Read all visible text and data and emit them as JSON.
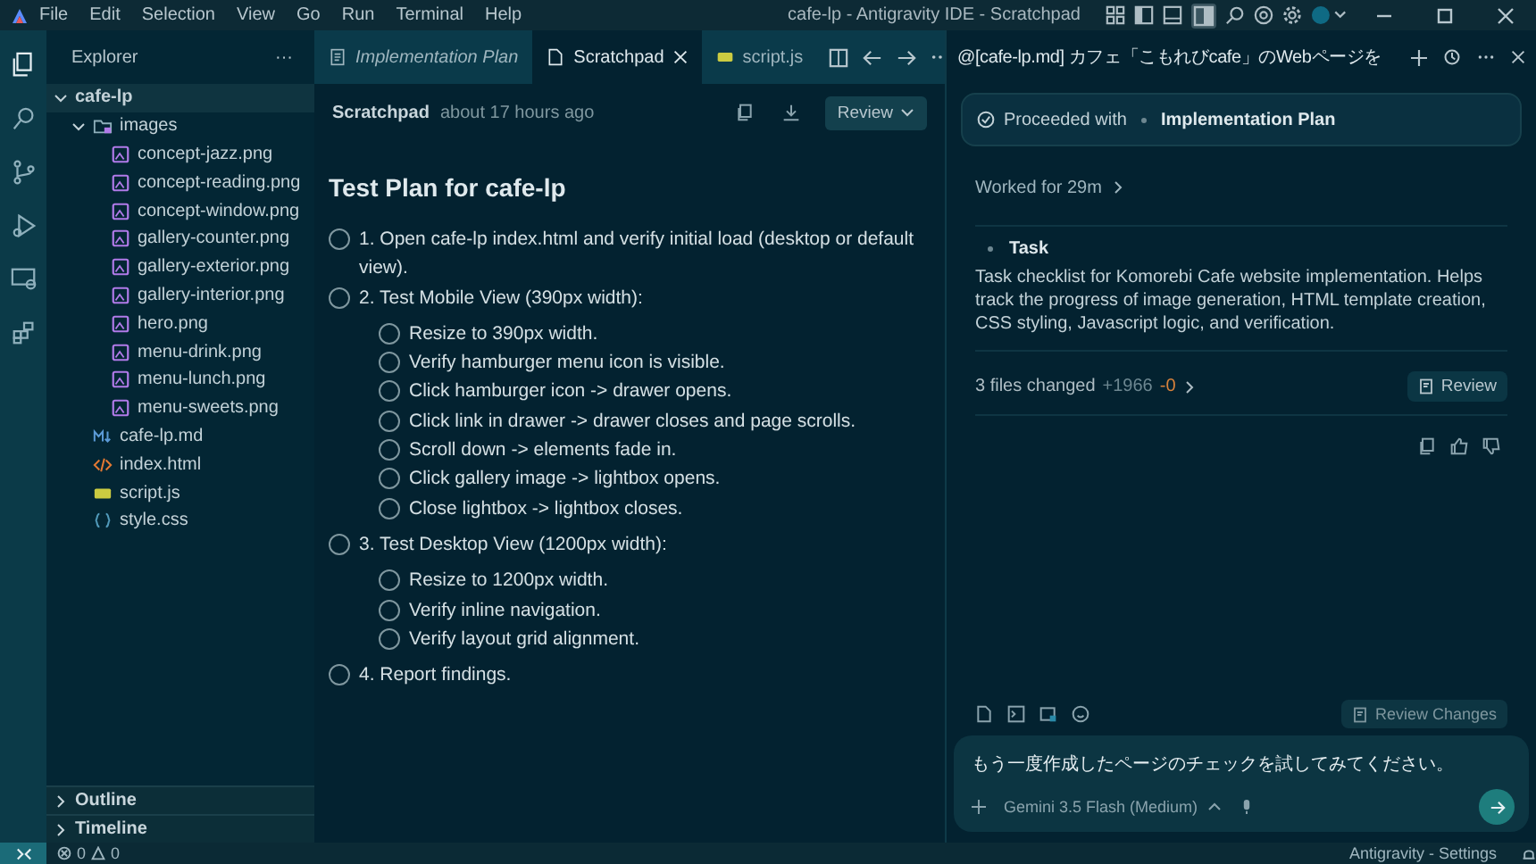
{
  "menu": [
    "File",
    "Edit",
    "Selection",
    "View",
    "Go",
    "Run",
    "Terminal",
    "Help"
  ],
  "window_title": "cafe-lp - Antigravity IDE - Scratchpad",
  "explorer": {
    "title": "Explorer",
    "more": "···",
    "tree": [
      {
        "label": "cafe-lp",
        "kind": "folder",
        "expanded": true,
        "selected": true,
        "children": [
          {
            "label": "images",
            "kind": "folder",
            "expanded": true,
            "selected": false,
            "children": [
              {
                "label": "concept-jazz.png",
                "kind": "image",
                "selected": false
              },
              {
                "label": "concept-reading.png",
                "kind": "image",
                "selected": false
              },
              {
                "label": "concept-window.png",
                "kind": "image",
                "selected": false
              },
              {
                "label": "gallery-counter.png",
                "kind": "image",
                "selected": false
              },
              {
                "label": "gallery-exterior.png",
                "kind": "image",
                "selected": false
              },
              {
                "label": "gallery-interior.png",
                "kind": "image",
                "selected": false
              },
              {
                "label": "hero.png",
                "kind": "image",
                "selected": false
              },
              {
                "label": "menu-drink.png",
                "kind": "image",
                "selected": false
              },
              {
                "label": "menu-lunch.png",
                "kind": "image",
                "selected": false
              },
              {
                "label": "menu-sweets.png",
                "kind": "image",
                "selected": false
              }
            ]
          },
          {
            "label": "cafe-lp.md",
            "kind": "markdown",
            "selected": false
          },
          {
            "label": "index.html",
            "kind": "html",
            "selected": false
          },
          {
            "label": "script.js",
            "kind": "js",
            "selected": false
          },
          {
            "label": "style.css",
            "kind": "css",
            "selected": false
          }
        ]
      }
    ],
    "sections": [
      {
        "label": "Outline",
        "expanded": false
      },
      {
        "label": "Timeline",
        "expanded": false
      }
    ]
  },
  "editor": {
    "tabs": [
      {
        "label": "Implementation Plan",
        "kind": "plan",
        "selected": false
      },
      {
        "label": "Scratchpad",
        "kind": "file",
        "selected": true
      },
      {
        "label": "script.js",
        "kind": "js",
        "selected": false
      }
    ],
    "header": {
      "title": "Scratchpad",
      "time": "about 17 hours ago",
      "review": "Review"
    },
    "heading": "Test Plan for cafe-lp",
    "items": [
      {
        "text": "1. Open cafe-lp index.html and verify initial load (desktop or default view).",
        "checked": false
      },
      {
        "text": "2. Test Mobile View (390px width):",
        "checked": false,
        "children": [
          {
            "text": "Resize to 390px width.",
            "checked": false
          },
          {
            "text": "Verify hamburger menu icon is visible.",
            "checked": false
          },
          {
            "text": "Click hamburger icon -> drawer opens.",
            "checked": false
          },
          {
            "text": "Click link in drawer -> drawer closes and page scrolls.",
            "checked": false
          },
          {
            "text": "Scroll down -> elements fade in.",
            "checked": false
          },
          {
            "text": "Click gallery image -> lightbox opens.",
            "checked": false
          },
          {
            "text": "Close lightbox -> lightbox closes.",
            "checked": false
          }
        ]
      },
      {
        "text": "3. Test Desktop View (1200px width):",
        "checked": false,
        "children": [
          {
            "text": "Resize to 1200px width.",
            "checked": false
          },
          {
            "text": "Verify inline navigation.",
            "checked": false
          },
          {
            "text": "Verify layout grid alignment.",
            "checked": false
          }
        ]
      },
      {
        "text": "4. Report findings.",
        "checked": false
      }
    ]
  },
  "chat": {
    "title": "@[cafe-lp.md] カフェ「こもれびcafe」のWebページを",
    "proceeded": {
      "label": "Proceeded with",
      "target": "Implementation Plan"
    },
    "worked": "Worked for 29m",
    "task": {
      "title": "Task",
      "description": "Task checklist for Komorebi Cafe website implementation. Helps track the progress of image generation, HTML template creation, CSS styling, Javascript logic, and verification."
    },
    "changes": {
      "label": "3 files changed",
      "added": "+1966",
      "removed": "-0",
      "review": "Review"
    },
    "review_changes": "Review Changes",
    "input": {
      "value": "もう一度作成したページのチェックを試してみてください。"
    },
    "model": "Gemini 3.5 Flash (Medium)"
  },
  "status_bar": {
    "errors": "0",
    "warnings": "0",
    "right": "Antigravity - Settings"
  }
}
